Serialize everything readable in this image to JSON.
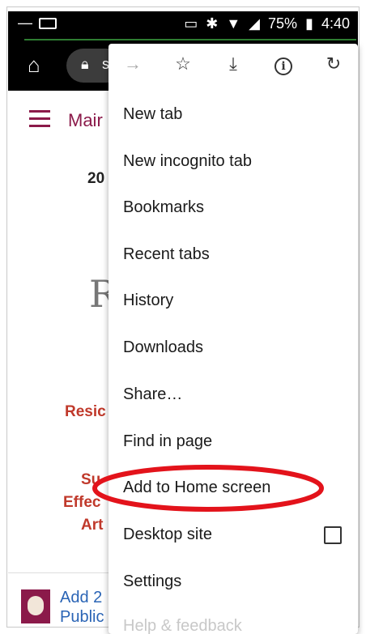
{
  "status_bar": {
    "left_icons": [
      "minus-icon",
      "pulse-icon"
    ],
    "right_icons": [
      "cast-icon",
      "bluetooth-icon",
      "wifi-icon",
      "signal-icon"
    ],
    "battery_percent": "75%",
    "time": "4:40"
  },
  "toolbar": {
    "omnibox_text": "s"
  },
  "page": {
    "header_label": "Mair",
    "year": "20",
    "logo_letter": "R",
    "red_texts": [
      "Resic",
      "Su",
      "Effec",
      "Art"
    ],
    "footer_text_line1": "Add 2",
    "footer_text_line2": "Public"
  },
  "menu": {
    "top_icons": [
      "forward-icon",
      "star-icon",
      "download-icon",
      "info-icon",
      "reload-icon"
    ],
    "items": [
      {
        "label": "New tab"
      },
      {
        "label": "New incognito tab"
      },
      {
        "label": "Bookmarks"
      },
      {
        "label": "Recent tabs"
      },
      {
        "label": "History"
      },
      {
        "label": "Downloads"
      },
      {
        "label": "Share…"
      },
      {
        "label": "Find in page"
      },
      {
        "label": "Add to Home screen"
      },
      {
        "label": "Desktop site"
      },
      {
        "label": "Settings"
      },
      {
        "label": "Help & feedback"
      }
    ]
  },
  "colors": {
    "annotation": "#e3131b",
    "brand": "#8b1a4a"
  }
}
